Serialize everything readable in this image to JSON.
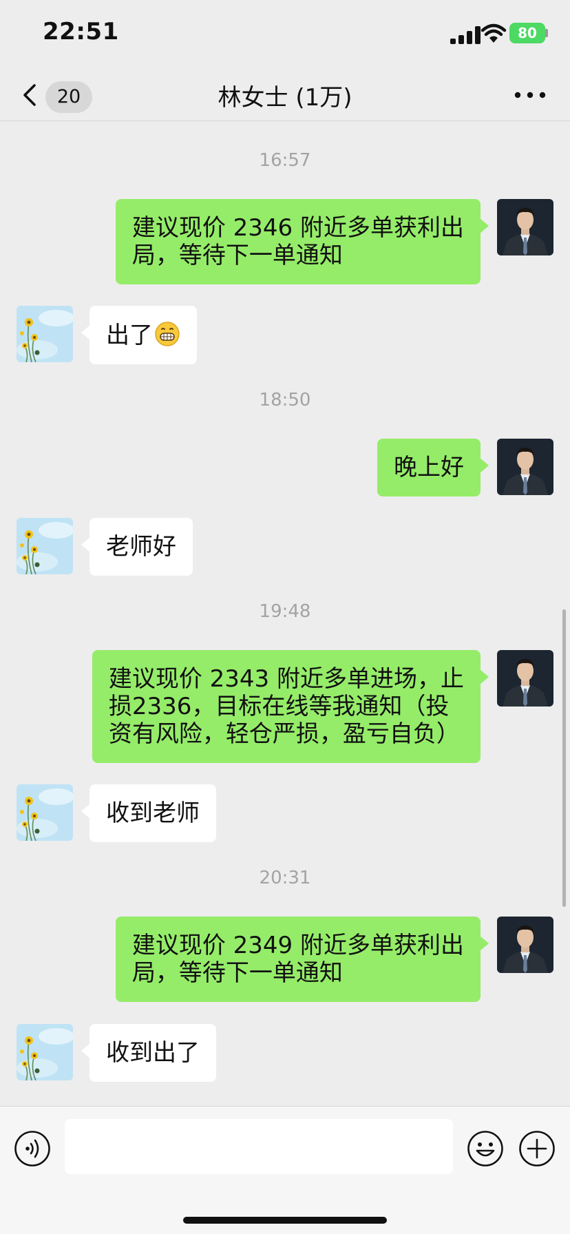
{
  "status_bar": {
    "time": "22:51",
    "battery": "80"
  },
  "nav": {
    "unread_count": "20",
    "title": "林女士 (1万)"
  },
  "messages": [
    {
      "time": "16:57"
    },
    {
      "side": "right",
      "text": "建议现价 2346 附近多单获利出\n局，等待下一单通知"
    },
    {
      "side": "left",
      "text": "出了",
      "emoji": "grinning-face-emoji"
    },
    {
      "time": "18:50"
    },
    {
      "side": "right",
      "text": "晚上好"
    },
    {
      "side": "left",
      "text": "老师好"
    },
    {
      "time": "19:48"
    },
    {
      "side": "right",
      "text": "建议现价 2343 附近多单进场，止\n损2336，目标在线等我通知（投\n资有风险，轻仓严损，盈亏自负）"
    },
    {
      "side": "left",
      "text": "收到老师"
    },
    {
      "time": "20:31"
    },
    {
      "side": "right",
      "text": "建议现价 2349 附近多单获利出\n局，等待下一单通知"
    },
    {
      "side": "left",
      "text": "收到出了"
    }
  ],
  "input": {
    "value": ""
  },
  "colors": {
    "sent_bubble": "#95ec69",
    "received_bubble": "#ffffff",
    "background": "#ededed"
  },
  "icons": {
    "back": "chevron-left-icon",
    "more": "more-dots-icon",
    "voice": "voice-icon",
    "emoji": "smiley-icon",
    "add": "plus-circle-icon",
    "wifi": "wifi-icon",
    "signal": "cellular-signal-icon",
    "battery": "battery-icon"
  }
}
